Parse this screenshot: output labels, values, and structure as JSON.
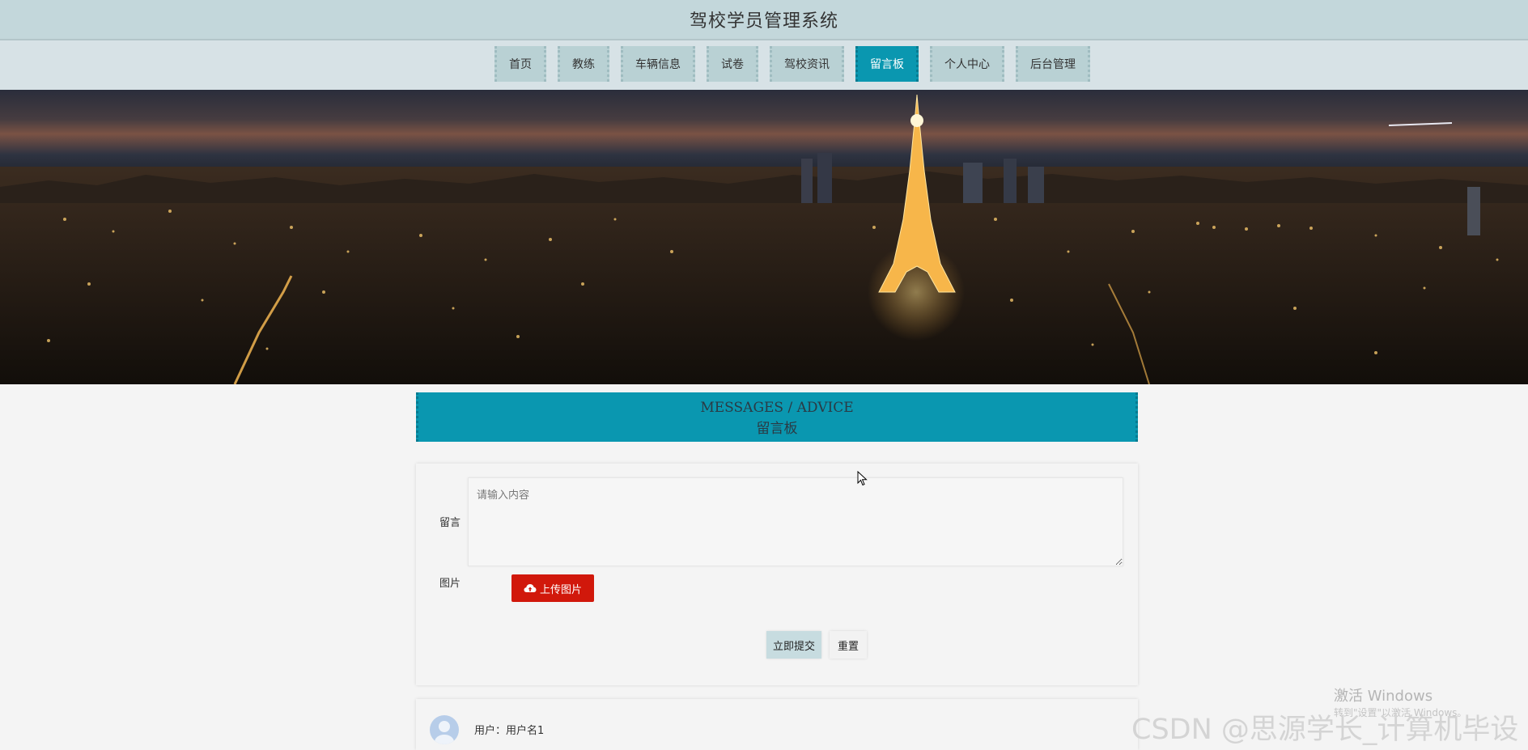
{
  "header": {
    "site_title": "驾校学员管理系统"
  },
  "nav": {
    "items": [
      {
        "label": "首页",
        "active": false
      },
      {
        "label": "教练",
        "active": false
      },
      {
        "label": "车辆信息",
        "active": false
      },
      {
        "label": "试卷",
        "active": false
      },
      {
        "label": "驾校资讯",
        "active": false
      },
      {
        "label": "留言板",
        "active": true
      },
      {
        "label": "个人中心",
        "active": false
      },
      {
        "label": "后台管理",
        "active": false
      }
    ]
  },
  "section": {
    "title_en": "MESSAGES / ADVICE",
    "title_cn": "留言板"
  },
  "form": {
    "message_label": "留言",
    "message_placeholder": "请输入内容",
    "image_label": "图片",
    "upload_label": "上传图片",
    "submit_label": "立即提交",
    "reset_label": "重置"
  },
  "comments": [
    {
      "user_prefix": "用户：",
      "username": "用户名1"
    }
  ],
  "overlays": {
    "windows_activation_title": "激活 Windows",
    "windows_activation_sub": "转到\"设置\"以激活 Windows。",
    "csdn_watermark": "CSDN @思源学长_计算机毕设"
  },
  "colors": {
    "accent": "#0a97b0",
    "upload": "#d1180b",
    "topbar": "#c3d7db",
    "nav": "#b9d1d4"
  },
  "icons": {
    "upload": "cloud-upload-icon",
    "avatar": "user-avatar-icon",
    "cursor": "mouse-pointer-icon"
  }
}
